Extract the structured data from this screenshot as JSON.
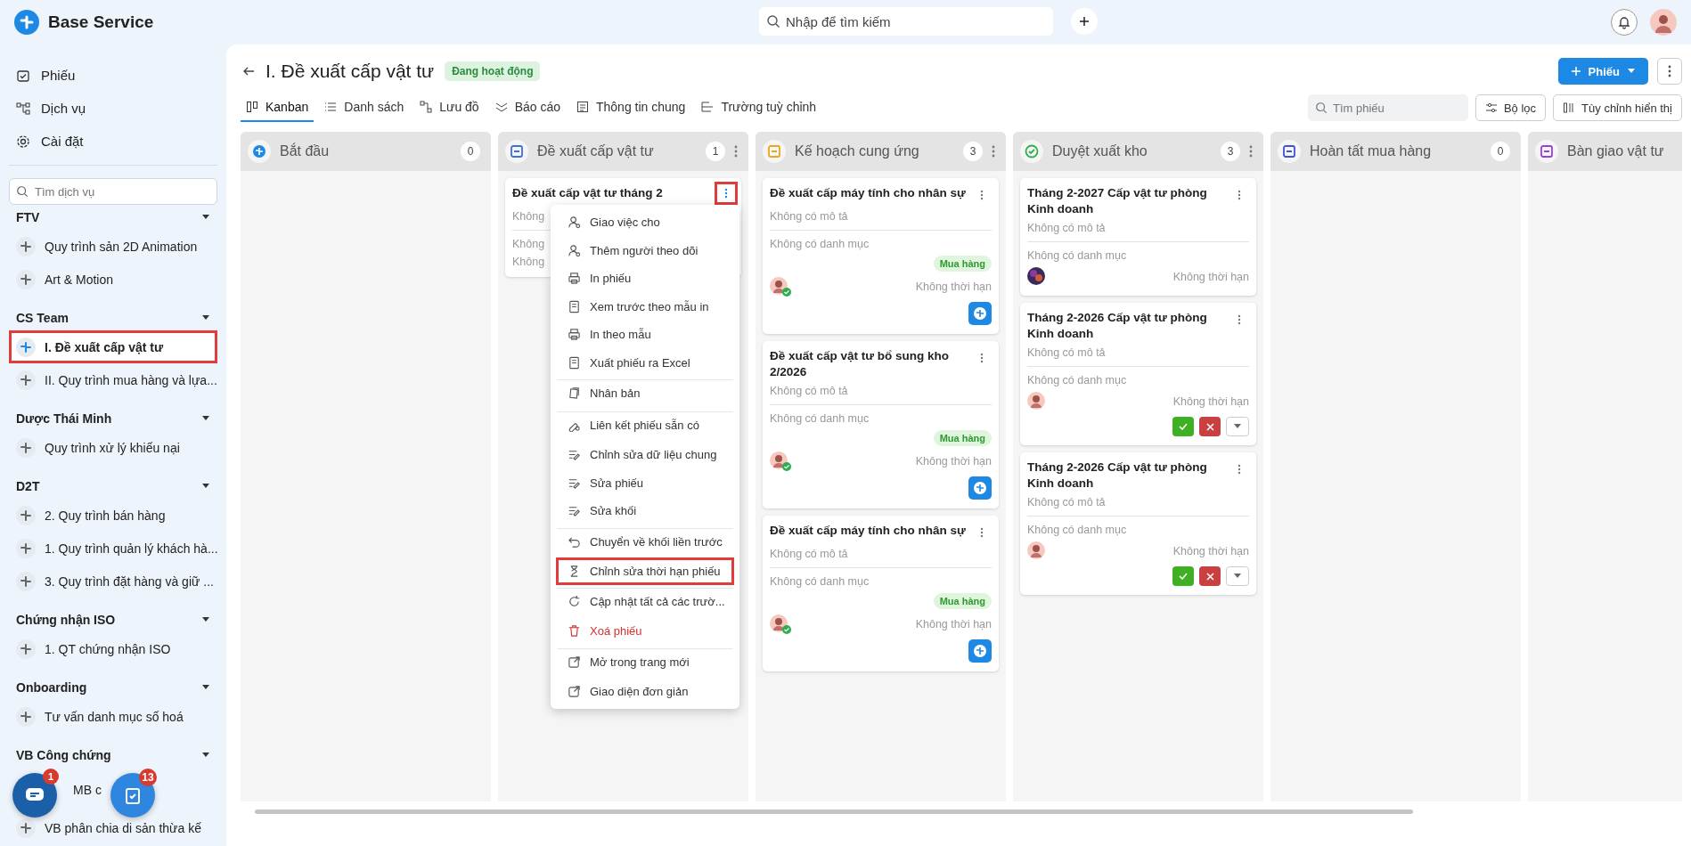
{
  "app": {
    "name": "Base Service",
    "search_placeholder": "Nhập để tìm kiếm"
  },
  "nav": [
    {
      "label": "Phiếu"
    },
    {
      "label": "Dịch vụ"
    },
    {
      "label": "Cài đặt"
    }
  ],
  "service_search": {
    "placeholder": "Tìm dịch vụ"
  },
  "groups": [
    {
      "name": "FTV",
      "items": [
        {
          "label": "Quy trình sản 2D Animation",
          "selected": false,
          "marked": false,
          "covered": false
        },
        {
          "label": "Art & Motion",
          "selected": false,
          "marked": false,
          "covered": false
        }
      ]
    },
    {
      "name": "CS Team",
      "items": [
        {
          "label": "I. Đề xuất cấp vật tư",
          "selected": true,
          "marked": true,
          "covered": false
        },
        {
          "label": "II. Quy trình mua hàng và lựa...",
          "selected": false,
          "marked": false,
          "covered": false
        }
      ]
    },
    {
      "name": "Dược Thái Minh",
      "items": [
        {
          "label": "Quy trình xử lý khiếu nại",
          "selected": false,
          "marked": false,
          "covered": false
        }
      ]
    },
    {
      "name": "D2T",
      "items": [
        {
          "label": "2. Quy trình bán hàng",
          "selected": false,
          "marked": false,
          "covered": false
        },
        {
          "label": "1. Quy trình quản lý khách hà...",
          "selected": false,
          "marked": false,
          "covered": false
        },
        {
          "label": "3. Quy trình đặt hàng và giữ ...",
          "selected": false,
          "marked": false,
          "covered": false
        }
      ]
    },
    {
      "name": "Chứng nhận ISO",
      "items": [
        {
          "label": "1. QT chứng nhận ISO",
          "selected": false,
          "marked": false,
          "covered": false
        }
      ]
    },
    {
      "name": "Onboarding",
      "items": [
        {
          "label": "Tư vấn danh mục số hoá",
          "selected": false,
          "marked": false,
          "covered": false
        }
      ]
    },
    {
      "name": "VB Công chứng",
      "items": [
        {
          "label": "MB c",
          "selected": false,
          "marked": false,
          "covered": true
        },
        {
          "label": "VB phân chia di sản thừa kế",
          "selected": false,
          "marked": false,
          "covered": false
        }
      ]
    }
  ],
  "floating": [
    {
      "kind": "chat",
      "badge": "1"
    },
    {
      "kind": "task",
      "badge": "13"
    }
  ],
  "page": {
    "title": "I. Đề xuất cấp vật tư",
    "status": "Đang hoạt động",
    "new_button": "Phiếu"
  },
  "tabs": [
    {
      "label": "Kanban",
      "selected": true
    },
    {
      "label": "Danh sách",
      "selected": false
    },
    {
      "label": "Lưu đồ",
      "selected": false
    },
    {
      "label": "Báo cáo",
      "selected": false
    },
    {
      "label": "Thông tin chung",
      "selected": false
    },
    {
      "label": "Trường tuỳ chỉnh",
      "selected": false
    }
  ],
  "tools": {
    "search_placeholder": "Tìm phiếu",
    "filter": "Bộ lọc",
    "customize": "Tùy chỉnh hiển thị"
  },
  "columns": [
    {
      "title": "Bắt đầu",
      "count": "0",
      "color": "#1e88e5",
      "more": false
    },
    {
      "title": "Đề xuất cấp vật tư",
      "count": "1",
      "color": "#3f6fd8",
      "more": true,
      "cards": [
        {
          "title": "Đề xuất cấp vật tư tháng 2",
          "description": "Không",
          "category": "Không",
          "extra": "Không",
          "app_badge": false,
          "actions": false,
          "marked": true,
          "menu_open": true
        }
      ]
    },
    {
      "title": "Kế hoạch cung ứng",
      "count": "3",
      "color": "#e6a817",
      "more": true,
      "cards": [
        {
          "title": "Đề xuất cấp máy tính cho nhân sự",
          "description": "Không có mô tả",
          "category": "Không có danh mục",
          "tag": "Mua hàng",
          "assignee": {
            "kind": "woman",
            "verified": true
          },
          "deadline": "Không thời hạn",
          "app_badge": true,
          "actions": false,
          "marked": false,
          "menu_open": false
        },
        {
          "title": "Đề xuất cấp vật tư bổ sung kho 2/2026",
          "description": "Không có mô tả",
          "category": "Không có danh mục",
          "tag": "Mua hàng",
          "assignee": {
            "kind": "woman",
            "verified": true
          },
          "deadline": "Không thời hạn",
          "app_badge": true,
          "actions": false,
          "marked": false,
          "menu_open": false
        },
        {
          "title": "Đề xuất cấp máy tính cho nhân sự",
          "description": "Không có mô tả",
          "category": "Không có danh mục",
          "tag": "Mua hàng",
          "assignee": {
            "kind": "woman",
            "verified": true
          },
          "deadline": "Không thời hạn",
          "app_badge": true,
          "actions": false,
          "marked": false,
          "menu_open": false
        }
      ]
    },
    {
      "title": "Duyệt xuất kho",
      "count": "3",
      "color": "#2eae4f",
      "more": true,
      "cards": [
        {
          "title": "Tháng 2-2027 Cấp vật tư phòng Kinh doanh",
          "description": "Không có mô tả",
          "category": "Không có danh mục",
          "assignee": {
            "kind": "photo",
            "verified": false
          },
          "deadline": "Không thời hạn",
          "app_badge": false,
          "actions": false,
          "marked": false,
          "menu_open": false
        },
        {
          "title": "Tháng 2-2026 Cấp vật tư phòng Kinh doanh",
          "description": "Không có mô tả",
          "category": "Không có danh mục",
          "assignee": {
            "kind": "woman",
            "verified": false
          },
          "deadline": "Không thời hạn",
          "app_badge": false,
          "actions": true,
          "marked": false,
          "menu_open": false
        },
        {
          "title": "Tháng 2-2026 Cấp vật tư phòng Kinh doanh",
          "description": "Không có mô tả",
          "category": "Không có danh mục",
          "assignee": {
            "kind": "woman",
            "verified": false
          },
          "deadline": "Không thời hạn",
          "app_badge": false,
          "actions": true,
          "marked": false,
          "menu_open": false
        }
      ]
    },
    {
      "title": "Hoàn tất mua hàng",
      "count": "0",
      "color": "#3f51d8",
      "more": false
    },
    {
      "title": "Bàn giao vật tư",
      "color": "#9c3fd8",
      "more": false
    }
  ],
  "card_menu": [
    {
      "label": "Giao việc cho",
      "kind": "normal",
      "divider_before": false,
      "marked": false
    },
    {
      "label": "Thêm người theo dõi",
      "kind": "normal",
      "divider_before": false,
      "marked": false
    },
    {
      "label": "In phiếu",
      "kind": "normal",
      "divider_before": false,
      "marked": false
    },
    {
      "label": "Xem trước theo mẫu in",
      "kind": "normal",
      "divider_before": false,
      "marked": false
    },
    {
      "label": "In theo mẫu",
      "kind": "normal",
      "divider_before": false,
      "marked": false
    },
    {
      "label": "Xuất phiếu ra Excel",
      "kind": "normal",
      "divider_before": false,
      "marked": false
    },
    {
      "label": "Nhân bản",
      "kind": "normal",
      "divider_before": true,
      "marked": false
    },
    {
      "label": "Liên kết phiếu sẵn có",
      "kind": "normal",
      "divider_before": true,
      "marked": false
    },
    {
      "label": "Chỉnh sửa dữ liệu chung",
      "kind": "normal",
      "divider_before": false,
      "marked": false
    },
    {
      "label": "Sửa phiếu",
      "kind": "normal",
      "divider_before": false,
      "marked": false
    },
    {
      "label": "Sửa khối",
      "kind": "normal",
      "divider_before": false,
      "marked": false
    },
    {
      "label": "Chuyển về khối liền trước",
      "kind": "normal",
      "divider_before": true,
      "marked": false
    },
    {
      "label": "Chỉnh sửa thời hạn phiếu",
      "kind": "normal",
      "divider_before": false,
      "marked": true
    },
    {
      "label": "Cập nhật tất cả các trườ...",
      "kind": "normal",
      "divider_before": true,
      "marked": false
    },
    {
      "label": "Xoá phiếu",
      "kind": "danger",
      "divider_before": false,
      "marked": false
    },
    {
      "label": "Mở trong trang mới",
      "kind": "normal",
      "divider_before": true,
      "marked": false
    },
    {
      "label": "Giao diện đơn giản",
      "kind": "normal",
      "divider_before": false,
      "marked": false
    }
  ]
}
